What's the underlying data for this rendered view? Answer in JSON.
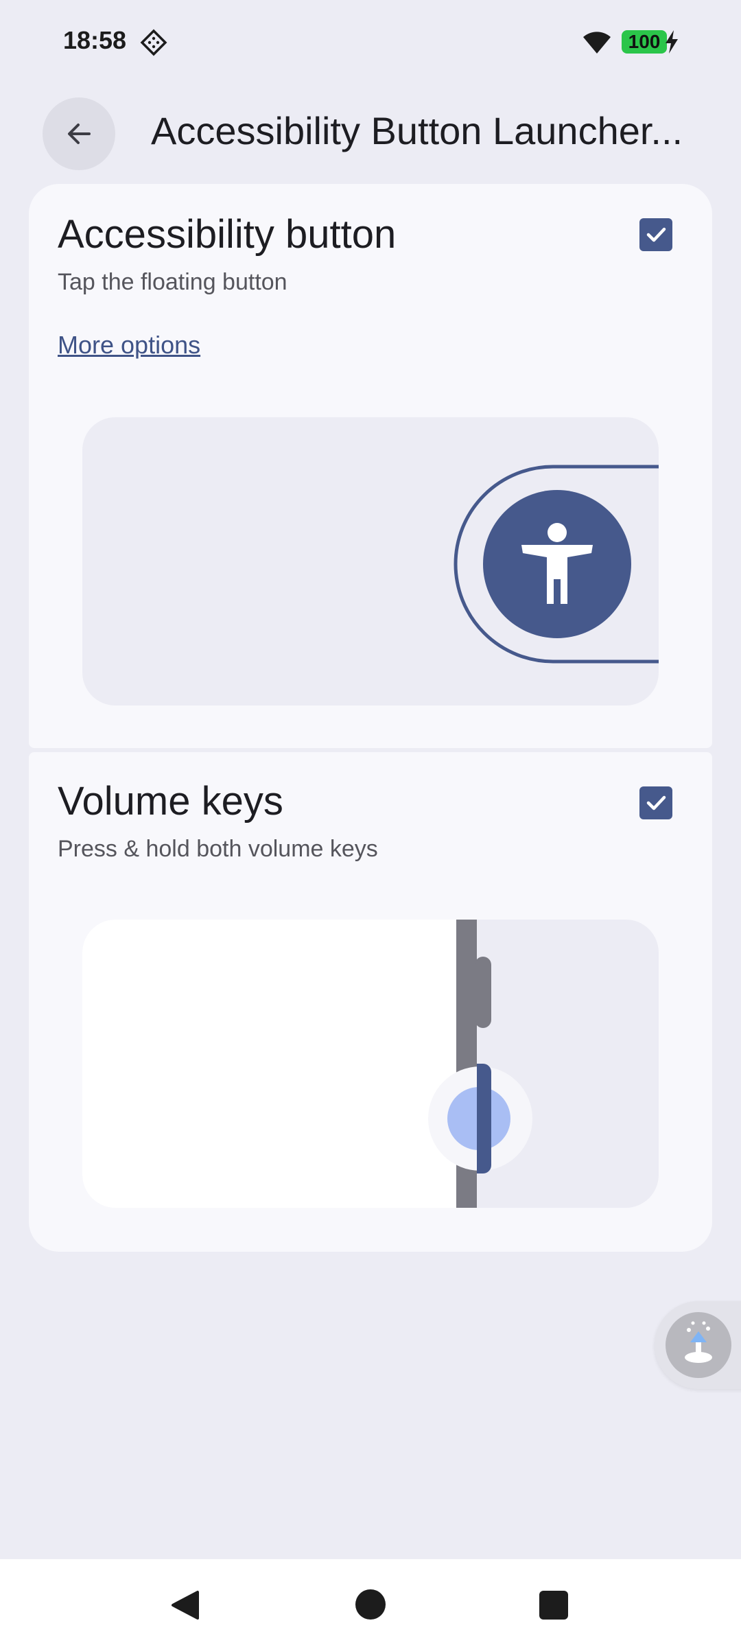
{
  "status": {
    "time": "18:58",
    "battery": "100"
  },
  "header": {
    "title": "Accessibility Button Launcher..."
  },
  "cards": [
    {
      "title": "Accessibility button",
      "subtitle": "Tap the floating button",
      "checked": true,
      "link": "More options"
    },
    {
      "title": "Volume keys",
      "subtitle": "Press & hold both volume keys",
      "checked": true
    }
  ],
  "colors": {
    "accent": "#46598C",
    "background": "#ECECF4",
    "card": "#F8F8FC"
  },
  "icons": [
    "back-arrow-icon",
    "accessibility-icon",
    "wifi-icon",
    "checkbox-checked-icon",
    "floating-assistant-icon"
  ]
}
